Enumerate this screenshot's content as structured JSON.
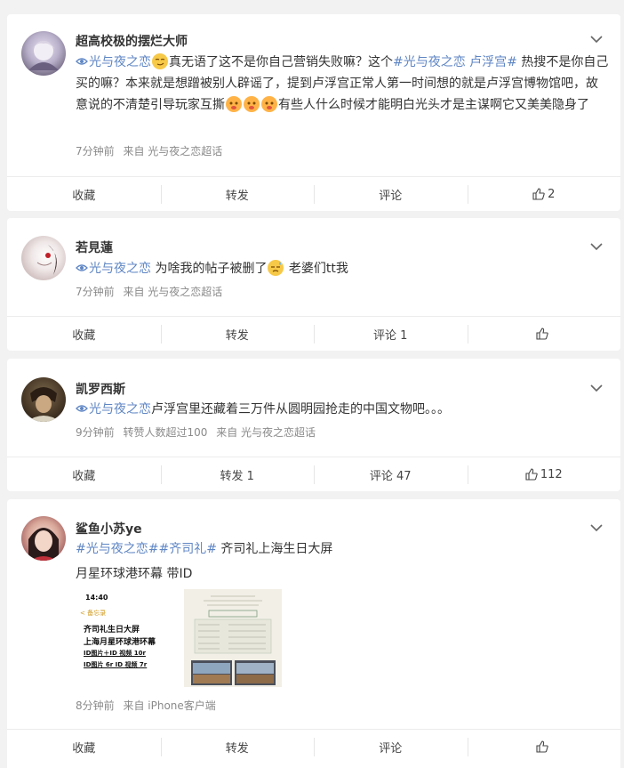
{
  "posts": [
    {
      "username": "超高校极的摆烂大师",
      "topic": "光与夜之恋",
      "text1": "真无语了这不是你自己营销失败嘛？这个",
      "hashtag": "#光与夜之恋 卢浮宫#",
      "text2": " 热搜不是你自己买的嘛？本来就是想蹭被别人辟谣了，提到卢浮宫正常人第一时间想的就是卢浮宫博物馆吧，故意说的不清楚引导玩家互撕",
      "text3": "有些人什么时候才能明白光头才是主谋啊它又美美隐身了",
      "time": "7分钟前",
      "source": "来自 光与夜之恋超话",
      "actions": {
        "collect": "收藏",
        "repost": "转发",
        "comment": "评论",
        "like_count": "2"
      }
    },
    {
      "username": "若見蓮",
      "topic": "光与夜之恋",
      "text1": " 为啥我的帖子被删了",
      "text2": " 老婆们tt我",
      "time": "7分钟前",
      "source": "来自 光与夜之恋超话",
      "actions": {
        "collect": "收藏",
        "repost": "转发",
        "comment": "评论 1",
        "like_count": ""
      }
    },
    {
      "username": "凯罗西斯",
      "topic": "光与夜之恋",
      "text1": "卢浮宫里还藏着三万件从圆明园抢走的中国文物吧。。。",
      "time": "9分钟前",
      "repost_note": "转赞人数超过100",
      "source": "来自 光与夜之恋超话",
      "actions": {
        "collect": "收藏",
        "repost": "转发 1",
        "comment": "评论 47",
        "like_count": "112"
      }
    },
    {
      "username": "鲨鱼小苏ye",
      "hashtag1": "#光与夜之恋#",
      "hashtag2": "#齐司礼#",
      "text1": " 齐司礼上海生日大屏",
      "text2": "月星环球港环幕 带ID",
      "time": "8分钟前",
      "source": "来自 iPhone客户端",
      "actions": {
        "collect": "收藏",
        "repost": "转发",
        "comment": "评论",
        "like_count": ""
      },
      "thumb1": {
        "clock": "14:40",
        "back": "< 备忘录",
        "line1": "齐司礼生日大屏",
        "line2": "上海月星环球港环幕",
        "line3": "ID图片＋ID 视频 10r",
        "line4": "ID图片 6r  ID 视频 7r"
      }
    }
  ],
  "colors": {
    "topic": "#5f86c4",
    "meta": "#8a8a8a",
    "background": "#f2f2f2"
  }
}
